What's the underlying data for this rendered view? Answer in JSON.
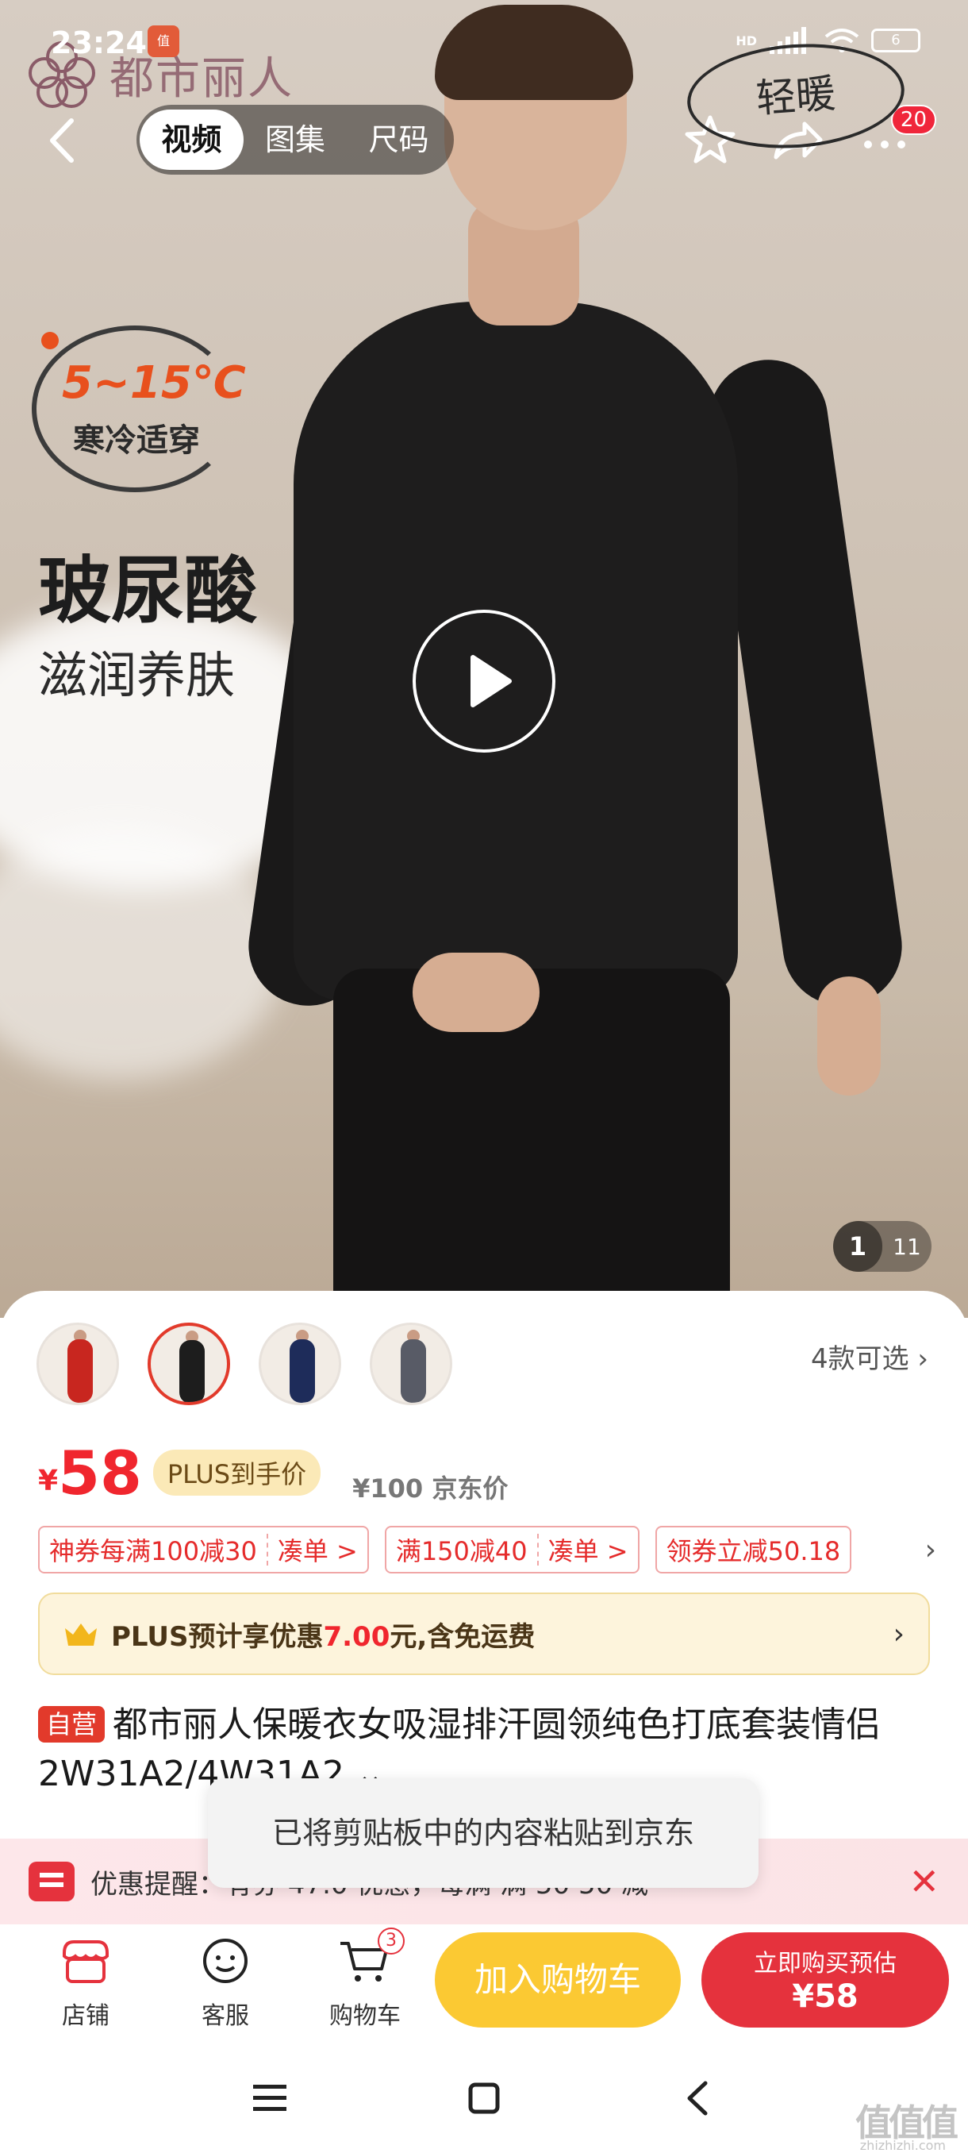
{
  "status_bar": {
    "time": "23:24",
    "app_badge": "值",
    "network": "HD",
    "battery": "6"
  },
  "hero": {
    "brand_name": "都市丽人",
    "tag_light_warm": "轻暖",
    "temp_range": "5~15℃",
    "temp_desc": "寒冷适穿",
    "promo_title": "玻尿酸",
    "promo_subtitle": "滋润养肤",
    "media_tabs": [
      "视频",
      "图集",
      "尺码"
    ],
    "active_tab": "视频",
    "notification_count": "20",
    "image_index": "1",
    "image_total": "11"
  },
  "variants": {
    "colors": [
      "#c8261f",
      "#1d1d1d",
      "#1e2c5a",
      "#585b66"
    ],
    "count_label": "4款可选"
  },
  "price": {
    "currency": "¥",
    "amount": "58",
    "plus_label": "PLUS到手价",
    "jd_price": "¥100 京东价"
  },
  "coupons": [
    {
      "left": "神券每满100减30",
      "right": "凑单 >"
    },
    {
      "left": "满150减40",
      "right": "凑单 >"
    },
    {
      "left": "领券立减50.18",
      "right": ""
    }
  ],
  "plus_bar": {
    "prefix": "PLUS预计享优惠",
    "amount": "7.00",
    "suffix": "元,含免运费"
  },
  "product": {
    "self_tag": "自营",
    "title": "都市丽人保暖衣女吸湿排汗圆领纯色打底套装情侣2W31A2/4W31A2"
  },
  "toast": {
    "text": "已将剪贴板中的内容粘贴到京东"
  },
  "reminder": {
    "text": "优惠提醒：有券 47.0 优惠，每满 满 50 50 减"
  },
  "bottom_bar": {
    "store": "店铺",
    "service": "客服",
    "cart": "购物车",
    "cart_count": "3",
    "add_to_cart": "加入购物车",
    "buy_now_label": "立即购买预估",
    "buy_now_price": "¥58"
  },
  "watermark": {
    "text": "值值值",
    "sub": "zhizhizhi.com"
  }
}
